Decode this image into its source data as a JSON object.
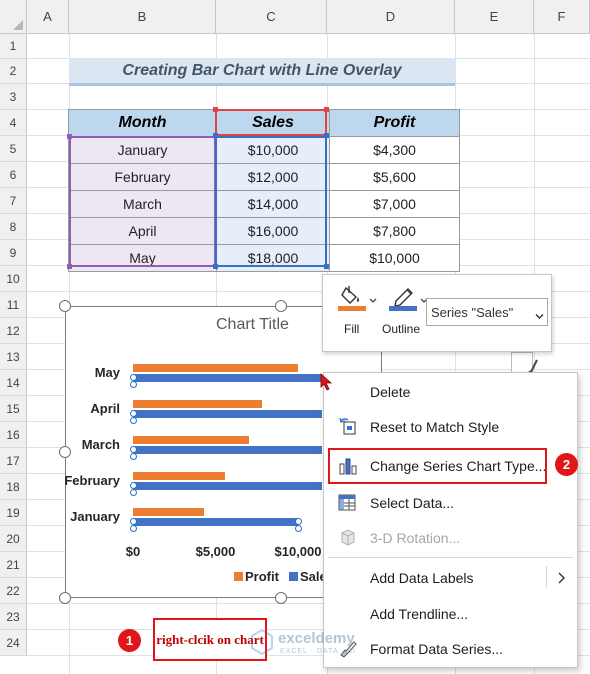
{
  "sheet": {
    "columns": [
      "A",
      "B",
      "C",
      "D",
      "E",
      "F"
    ],
    "rows": [
      "1",
      "2",
      "3",
      "4",
      "5",
      "6",
      "7",
      "8",
      "9",
      "10",
      "11",
      "12",
      "13",
      "14",
      "15",
      "16",
      "17",
      "18",
      "19",
      "20",
      "21",
      "22",
      "23",
      "24"
    ],
    "title": "Creating Bar Chart with Line Overlay"
  },
  "table": {
    "headers": [
      "Month",
      "Sales",
      "Profit"
    ],
    "rows": [
      [
        "January",
        "$10,000",
        "$4,300"
      ],
      [
        "February",
        "$12,000",
        "$5,600"
      ],
      [
        "March",
        "$14,000",
        "$7,000"
      ],
      [
        "April",
        "$16,000",
        "$7,800"
      ],
      [
        "May",
        "$18,000",
        "$10,000"
      ]
    ]
  },
  "chart_data": {
    "type": "bar",
    "orientation": "horizontal",
    "title": "Chart Title",
    "categories": [
      "January",
      "February",
      "March",
      "April",
      "May"
    ],
    "series": [
      {
        "name": "Profit",
        "values": [
          4300,
          5600,
          7000,
          7800,
          10000
        ],
        "color": "#ed7d31"
      },
      {
        "name": "Sales",
        "values": [
          10000,
          12000,
          14000,
          16000,
          18000
        ],
        "color": "#4472c4"
      }
    ],
    "x_ticks": [
      "$0",
      "$5,000",
      "$10,000"
    ],
    "legend_labels": [
      "Profit",
      "Sale"
    ],
    "xlim": [
      0,
      20000
    ],
    "legend_position": "bottom",
    "selected_series": "Sales",
    "note": "right-clcik on chart"
  },
  "format_toolbar": {
    "fill_label": "Fill",
    "outline_label": "Outline",
    "series_select": "Series \"Sales\"",
    "icons": [
      "paint-bucket-icon",
      "pen-outline-icon",
      "chevron-down-icon"
    ]
  },
  "context_menu": {
    "items": [
      {
        "label": "Delete",
        "enabled": true,
        "icon": null
      },
      {
        "label": "Reset to Match Style",
        "enabled": true,
        "icon": "reset-style-icon"
      },
      {
        "label": "Change Series Chart Type...",
        "enabled": true,
        "icon": "bar-chart-icon"
      },
      {
        "label": "Select Data...",
        "enabled": true,
        "icon": "select-data-icon"
      },
      {
        "label": "3-D Rotation...",
        "enabled": false,
        "icon": "cube-icon"
      },
      {
        "label": "Add Data Labels",
        "enabled": true,
        "icon": null,
        "submenu": true
      },
      {
        "label": "Add Trendline...",
        "enabled": true,
        "icon": null
      },
      {
        "label": "Format Data Series...",
        "enabled": true,
        "icon": "format-brush-icon"
      }
    ]
  },
  "annotations": {
    "step1": "1",
    "step2": "2"
  },
  "watermark": {
    "brand": "exceldemy",
    "tagline": "EXCEL · DATA · BI"
  },
  "colors": {
    "accent_red": "#e0161b",
    "header_blue": "#bdd7ee",
    "profit": "#ed7d31",
    "sales": "#4472c4"
  }
}
